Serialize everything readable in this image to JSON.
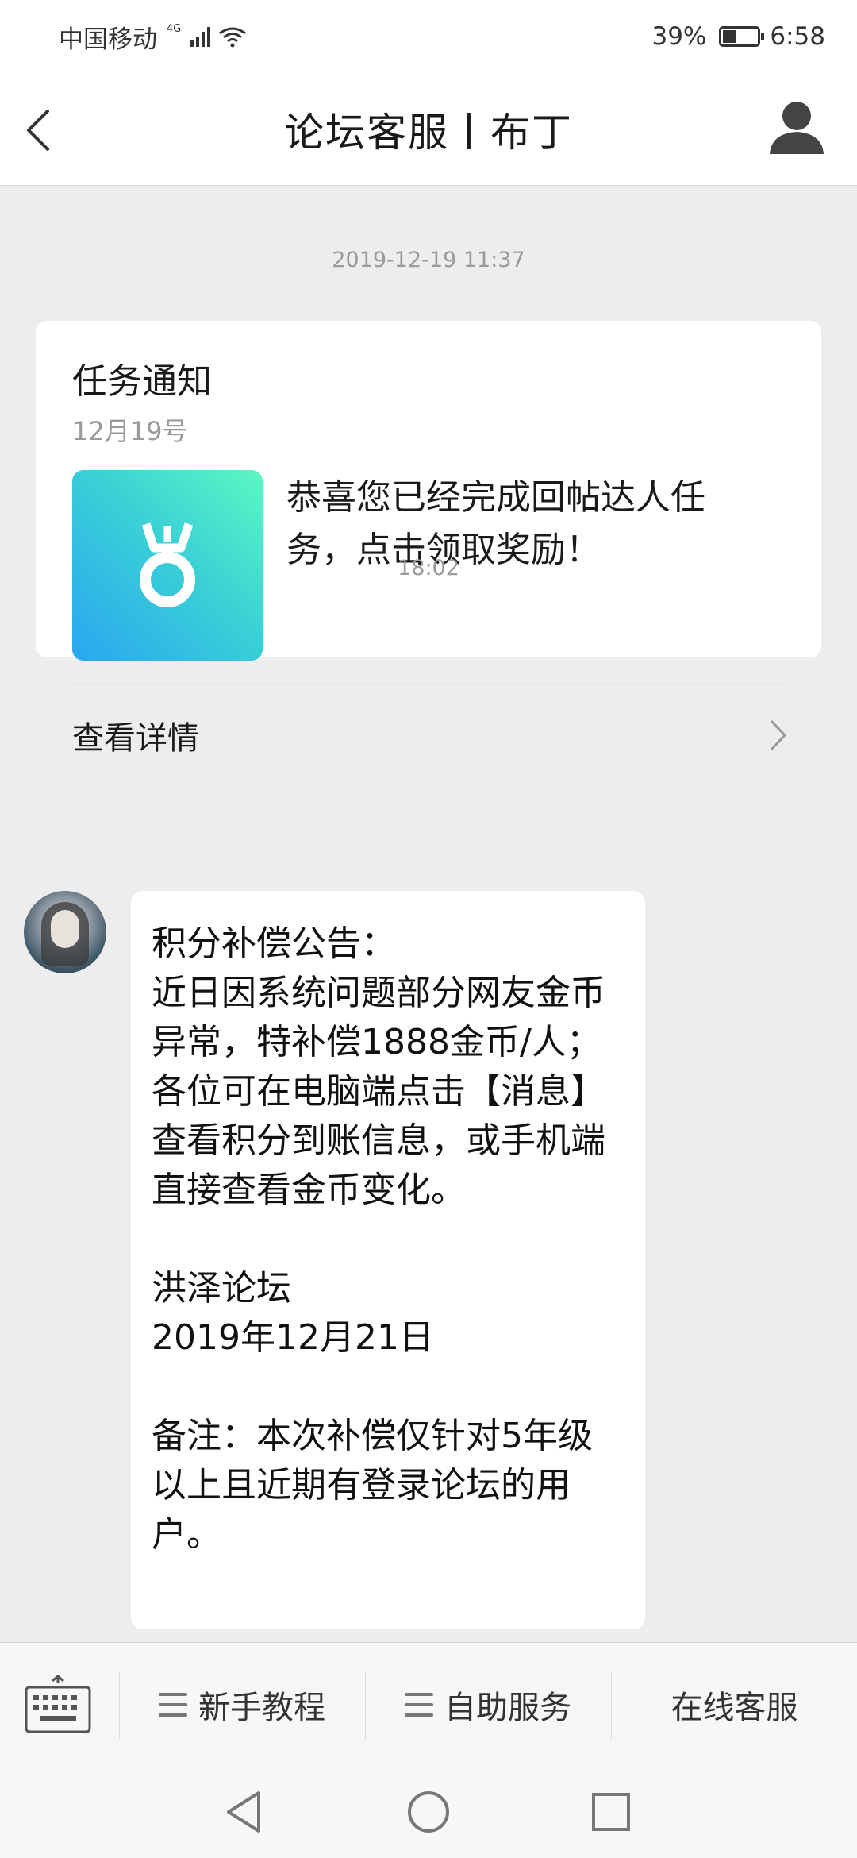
{
  "status_bar": {
    "carrier": "中国移动",
    "network": "4G",
    "battery_percent": "39%",
    "battery_level": 0.39,
    "time": "6:58"
  },
  "header": {
    "title": "论坛客服丨布丁",
    "back_icon": "back-chevron-icon",
    "user_icon": "user-profile-icon"
  },
  "chat": {
    "timestamp_1": "2019-12-19 11:37",
    "task_card": {
      "title": "任务通知",
      "date": "12月19号",
      "icon": "medal-icon",
      "message": "恭喜您已经完成回帖达人任务，点击领取奖励！",
      "detail_label": "查看详情",
      "chevron_icon": "chevron-right-icon"
    },
    "timestamp_2": "18:02",
    "message": {
      "sender_avatar": "avatar",
      "lines": [
        "积分补偿公告：",
        "近日因系统问题部分网友金币异常，特补偿1888金币/人；各位可在电脑端点击【消息】查看积分到账信息，或手机端直接查看金币变化。",
        "",
        "洪泽论坛",
        "2019年12月21日",
        "",
        "备注：本次补偿仅针对5年级以上且近期有登录论坛的用户。"
      ]
    }
  },
  "bottom_menu": {
    "keyboard_icon": "keyboard-icon",
    "items": [
      {
        "label": "新手教程",
        "icon": "menu-icon"
      },
      {
        "label": "自助服务",
        "icon": "menu-icon"
      },
      {
        "label": "在线客服"
      }
    ]
  },
  "system_nav": {
    "back": "nav-back-icon",
    "home": "nav-home-icon",
    "recents": "nav-recents-icon"
  }
}
